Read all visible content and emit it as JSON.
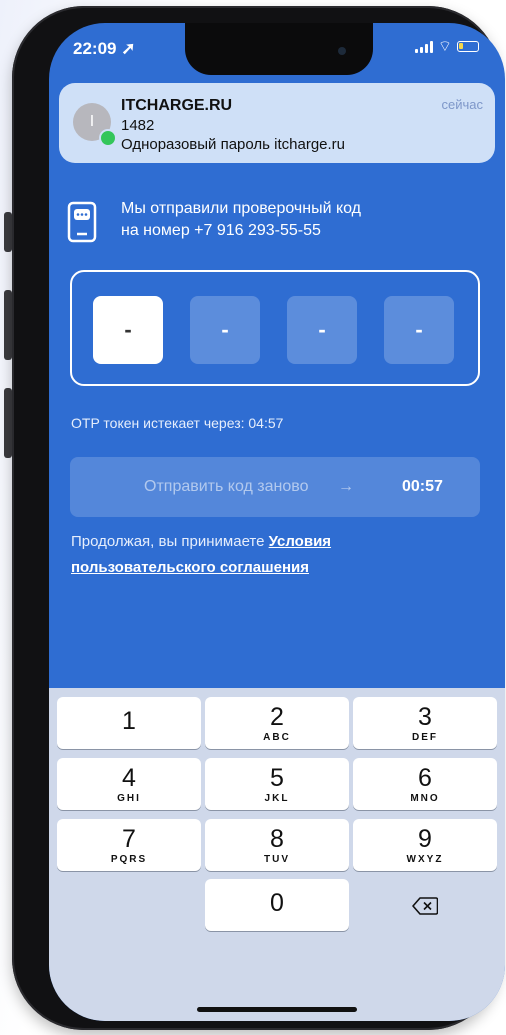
{
  "status_bar": {
    "time": "22:09"
  },
  "notification": {
    "app": "ITCHARGE.RU",
    "avatar_letter": "I",
    "code": "1482",
    "message": "Одноразовый пароль itcharge.ru",
    "time": "сейчас"
  },
  "sent": {
    "line1": "Мы отправили проверочный код",
    "line2": "на номер +7 916 293-55-55"
  },
  "otp": {
    "cells": [
      "-",
      "-",
      "-",
      "-"
    ]
  },
  "expire_text": "OTP токен истекает через: 04:57",
  "resend": {
    "label": "Отправить код заново",
    "arrow": "→",
    "timer": "00:57"
  },
  "terms": {
    "prefix": "Продолжая, вы принимаете ",
    "link_part1": "Условия",
    "link_part2": "пользовательского соглашения"
  },
  "keypad": {
    "keys": [
      {
        "num": "1",
        "sub": ""
      },
      {
        "num": "2",
        "sub": "ABC"
      },
      {
        "num": "3",
        "sub": "DEF"
      },
      {
        "num": "4",
        "sub": "GHI"
      },
      {
        "num": "5",
        "sub": "JKL"
      },
      {
        "num": "6",
        "sub": "MNO"
      },
      {
        "num": "7",
        "sub": "PQRS"
      },
      {
        "num": "8",
        "sub": "TUV"
      },
      {
        "num": "9",
        "sub": "WXYZ"
      },
      {
        "num": "0",
        "sub": ""
      }
    ],
    "delete_icon": "backspace-icon"
  },
  "colors": {
    "accent": "#2f6dd2",
    "keyboard_bg": "#cfd8ea",
    "notification_bg": "#cfe0f7"
  }
}
